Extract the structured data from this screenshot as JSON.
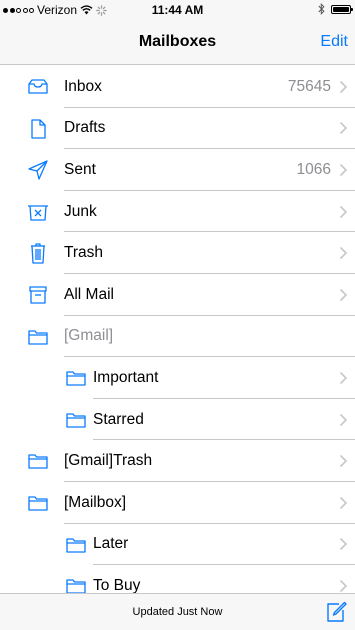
{
  "status_bar": {
    "carrier": "Verizon",
    "time": "11:44 AM"
  },
  "nav": {
    "title": "Mailboxes",
    "edit_label": "Edit"
  },
  "mailboxes": [
    {
      "label": "Inbox",
      "count": "75645",
      "icon": "inbox-icon",
      "level": 0
    },
    {
      "label": "Drafts",
      "count": "",
      "icon": "drafts-icon",
      "level": 0
    },
    {
      "label": "Sent",
      "count": "1066",
      "icon": "sent-icon",
      "level": 0
    },
    {
      "label": "Junk",
      "count": "",
      "icon": "junk-icon",
      "level": 0
    },
    {
      "label": "Trash",
      "count": "",
      "icon": "trash-icon",
      "level": 0
    },
    {
      "label": "All Mail",
      "count": "",
      "icon": "archive-icon",
      "level": 0
    },
    {
      "label": "[Gmail]",
      "count": "",
      "icon": "folder-icon",
      "level": 0
    },
    {
      "label": "Important",
      "count": "",
      "icon": "folder-icon",
      "level": 1
    },
    {
      "label": "Starred",
      "count": "",
      "icon": "folder-icon",
      "level": 1
    },
    {
      "label": "[Gmail]Trash",
      "count": "",
      "icon": "folder-icon",
      "level": 0
    },
    {
      "label": "[Mailbox]",
      "count": "",
      "icon": "folder-icon",
      "level": 0
    },
    {
      "label": "Later",
      "count": "",
      "icon": "folder-icon",
      "level": 1
    },
    {
      "label": "To Buy",
      "count": "",
      "icon": "folder-icon",
      "level": 1
    }
  ],
  "toolbar": {
    "status": "Updated Just Now",
    "compose_icon": "compose-icon"
  },
  "colors": {
    "accent": "#0a7aff",
    "secondary_text": "#8e8e93",
    "separator": "#c8c7cc",
    "bar_background": "#f7f7f7"
  }
}
